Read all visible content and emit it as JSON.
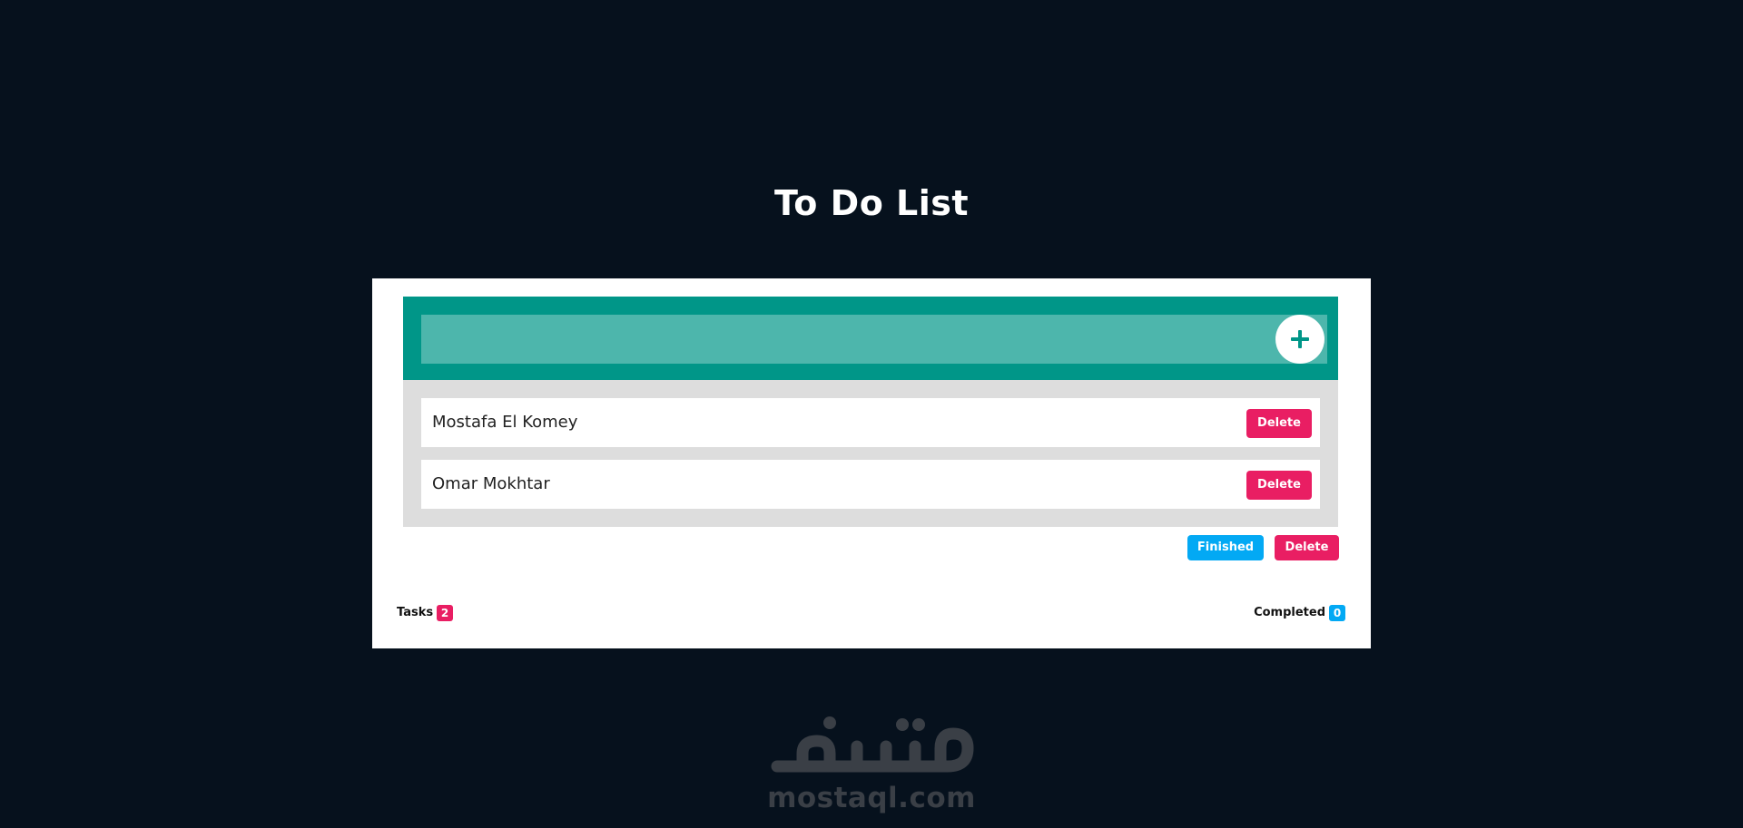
{
  "page": {
    "title": "To Do List"
  },
  "input": {
    "value": "",
    "placeholder": "",
    "add_icon": "plus-icon"
  },
  "tasks": [
    {
      "text": "Mostafa El Komey",
      "delete_label": "Delete"
    },
    {
      "text": "Omar Mokhtar",
      "delete_label": "Delete"
    }
  ],
  "actions": {
    "finished_label": "Finished",
    "delete_label": "Delete"
  },
  "stats": {
    "tasks_label": "Tasks",
    "tasks_count": "2",
    "completed_label": "Completed",
    "completed_count": "0"
  },
  "watermark": {
    "logo_text": "مستقل",
    "url": "mostaql.com"
  },
  "colors": {
    "background": "#06111d",
    "teal": "#009688",
    "teal_light": "#4db6ac",
    "list_bg": "#dddddd",
    "delete": "#e91e63",
    "finished": "#03a9f4"
  }
}
